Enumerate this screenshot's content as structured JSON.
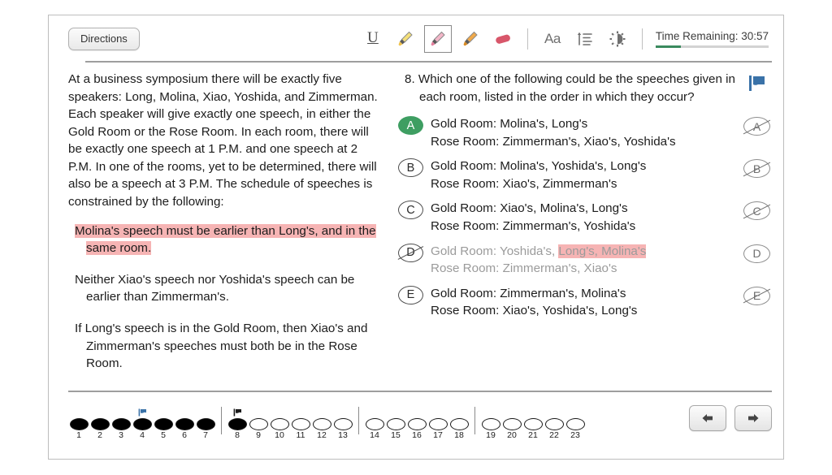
{
  "toolbar": {
    "directions_label": "Directions",
    "tools": [
      {
        "name": "underline-tool",
        "glyph": "U",
        "selected": false
      },
      {
        "name": "highlighter-yellow-tool",
        "color": "#f5e07a",
        "selected": false
      },
      {
        "name": "highlighter-pink-tool",
        "color": "#f3b6c8",
        "selected": true
      },
      {
        "name": "highlighter-orange-tool",
        "color": "#f0a94a",
        "selected": false
      },
      {
        "name": "eraser-tool",
        "color": "#d8566a",
        "selected": false
      },
      {
        "name": "font-size-tool",
        "glyph": "Aa",
        "selected": false
      },
      {
        "name": "line-spacing-tool",
        "selected": false
      },
      {
        "name": "brightness-tool",
        "selected": false
      }
    ],
    "time_label": "Time Remaining: 30:57",
    "time_progress_percent": 22,
    "time_bar_color": "#3a8a5e"
  },
  "passage": {
    "intro": "At a business symposium there will be exactly five speakers: Long, Molina, Xiao, Yoshida, and Zimmerman. Each speaker will give exactly one speech, in either the Gold Room or the Rose Room. In each room, there will be exactly one speech at 1 P.M. and one speech at 2 P.M. In one of the rooms, yet to be determined, there will also be a speech at 3 P.M. The schedule of speeches is constrained by the following:",
    "rules": [
      {
        "text": "Molina's speech must be earlier than Long's, and in the same room.",
        "highlighted": true,
        "highlight_color": "#f6b4b4"
      },
      {
        "text": "Neither Xiao's speech nor Yoshida's speech can be earlier than Zimmerman's.",
        "highlighted": false
      },
      {
        "text": "If Long's speech is in the Gold Room, then Xiao's and Zimmerman's speeches must both be in the Rose Room.",
        "highlighted": false
      }
    ]
  },
  "question": {
    "number": "8.",
    "stem": "Which one of the following could be the speeches given in each room, listed in the order in which they occur?",
    "flag_color": "#3a72a8",
    "choices": [
      {
        "letter": "A",
        "line1": "Gold Room: Molina's, Long's",
        "line2": "Rose Room: Zimmerman's, Xiao's, Yoshida's",
        "selected": true,
        "crossed": false,
        "crossout_button_letter": "A",
        "crossout_button_struck": true
      },
      {
        "letter": "B",
        "line1": "Gold Room: Molina's, Yoshida's, Long's",
        "line2": "Rose Room: Xiao's, Zimmerman's",
        "selected": false,
        "crossed": false,
        "crossout_button_letter": "B",
        "crossout_button_struck": true
      },
      {
        "letter": "C",
        "line1": "Gold Room: Xiao's, Molina's, Long's",
        "line2": "Rose Room: Zimmerman's, Yoshida's",
        "selected": false,
        "crossed": false,
        "crossout_button_letter": "C",
        "crossout_button_struck": true
      },
      {
        "letter": "D",
        "line1_plain": "Gold Room: Yoshida's, ",
        "line1_highlighted": "Long's, Molina's",
        "line2": "Rose Room: Zimmerman's, Xiao's",
        "selected": false,
        "crossed": true,
        "crossout_button_letter": "D",
        "crossout_button_struck": false
      },
      {
        "letter": "E",
        "line1": "Gold Room: Zimmerman's, Molina's",
        "line2": "Rose Room: Xiao's, Yoshida's, Long's",
        "selected": false,
        "crossed": false,
        "crossout_button_letter": "E",
        "crossout_button_struck": true
      }
    ]
  },
  "bottom_nav": {
    "questions": [
      {
        "label": "1",
        "answered": true,
        "flag": "none"
      },
      {
        "label": "2",
        "answered": true,
        "flag": "none"
      },
      {
        "label": "3",
        "answered": true,
        "flag": "none"
      },
      {
        "label": "4",
        "answered": true,
        "flag": "blue"
      },
      {
        "label": "5",
        "answered": true,
        "flag": "none"
      },
      {
        "label": "6",
        "answered": true,
        "flag": "none"
      },
      {
        "label": "7",
        "answered": true,
        "flag": "none",
        "divider_after": true
      },
      {
        "label": "8",
        "answered": true,
        "flag": "dark"
      },
      {
        "label": "9",
        "answered": false,
        "flag": "none"
      },
      {
        "label": "10",
        "answered": false,
        "flag": "none"
      },
      {
        "label": "11",
        "answered": false,
        "flag": "none"
      },
      {
        "label": "12",
        "answered": false,
        "flag": "none"
      },
      {
        "label": "13",
        "answered": false,
        "flag": "none",
        "divider_after": true
      },
      {
        "label": "14",
        "answered": false,
        "flag": "none"
      },
      {
        "label": "15",
        "answered": false,
        "flag": "none"
      },
      {
        "label": "16",
        "answered": false,
        "flag": "none"
      },
      {
        "label": "17",
        "answered": false,
        "flag": "none"
      },
      {
        "label": "18",
        "answered": false,
        "flag": "none",
        "divider_after": true
      },
      {
        "label": "19",
        "answered": false,
        "flag": "none"
      },
      {
        "label": "20",
        "answered": false,
        "flag": "none"
      },
      {
        "label": "21",
        "answered": false,
        "flag": "none"
      },
      {
        "label": "22",
        "answered": false,
        "flag": "none"
      },
      {
        "label": "23",
        "answered": false,
        "flag": "none"
      }
    ],
    "prev_icon": "arrow-left-icon",
    "next_icon": "arrow-right-icon"
  }
}
